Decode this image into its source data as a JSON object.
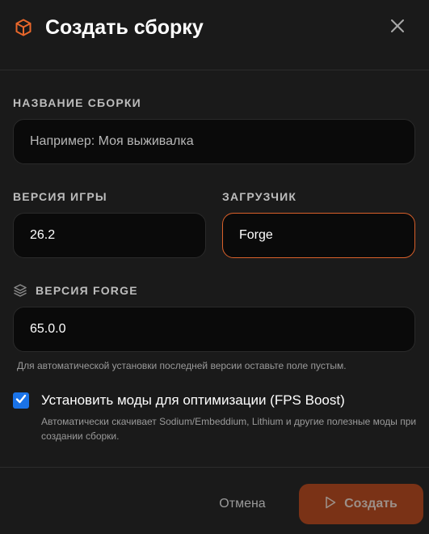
{
  "header": {
    "icon": "box-icon",
    "title": "Создать сборку",
    "close_icon": "close-icon"
  },
  "name_section": {
    "label": "НАЗВАНИЕ СБОРКИ",
    "placeholder": "Например: Моя выживалка"
  },
  "game_version": {
    "label": "ВЕРСИЯ ИГРЫ",
    "value": "26.2"
  },
  "loader": {
    "label": "ЗАГРУЗЧИК",
    "value": "Forge"
  },
  "forge_version": {
    "icon": "layers-icon",
    "label": "ВЕРСИЯ FORGE",
    "value": "65.0.0",
    "hint": "Для автоматической установки последней версии оставьте поле пустым."
  },
  "fps_boost": {
    "checked": true,
    "title": "Установить моды для оптимизации (FPS Boost)",
    "description": "Автоматически скачивает Sodium/Embeddium, Lithium и другие полезные моды при создании сборки."
  },
  "footer": {
    "cancel_label": "Отмена",
    "create_label": "Создать",
    "create_icon": "play-icon"
  },
  "colors": {
    "accent": "#d9602a",
    "checkbox": "#1a73e8",
    "create_button": "#7a3216"
  }
}
